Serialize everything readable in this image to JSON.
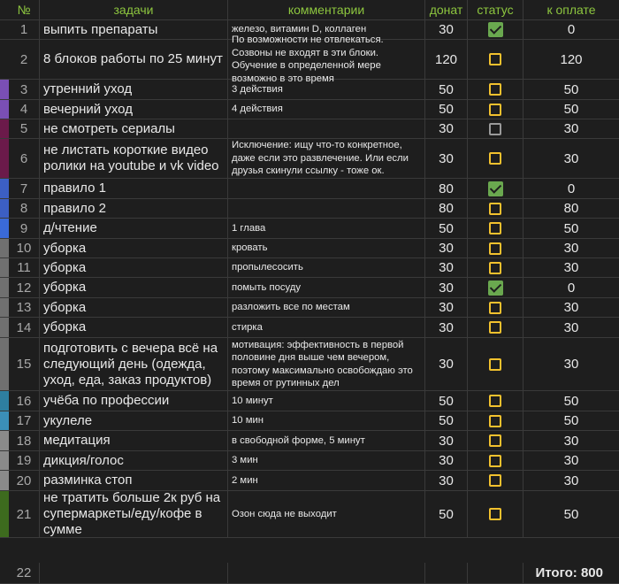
{
  "header": {
    "num": "№",
    "task": "задачи",
    "comment": "комментарии",
    "donat": "донат",
    "status": "статус",
    "pay": "к оплате"
  },
  "colors": {
    "header_text": "#8dc63f",
    "checked": "#6aa84f",
    "unchecked": "#f2c12e",
    "unchecked_gray": "#9a9a9a"
  },
  "rows": [
    {
      "num": "1",
      "task": "выпить препараты",
      "comment": "железо, витамин D, коллаген",
      "donat": "30",
      "status": "checked",
      "pay": "0",
      "strip": "#1e1e1e"
    },
    {
      "num": "2",
      "task": "8 блоков работы по 25 минут",
      "comment": "По возможности не отвлекаться. Созвоны не входят в эти блоки. Обучение в определенной мере возможно в это время",
      "donat": "120",
      "status": "unchecked",
      "pay": "120",
      "strip": "#1e1e1e"
    },
    {
      "num": "3",
      "task": "утренний уход",
      "comment": "3 действия",
      "donat": "50",
      "status": "unchecked",
      "pay": "50",
      "strip": "#7a4fb5"
    },
    {
      "num": "4",
      "task": "вечерний уход",
      "comment": "4 действия",
      "donat": "50",
      "status": "unchecked",
      "pay": "50",
      "strip": "#7a4fb5"
    },
    {
      "num": "5",
      "task": "не смотреть сериалы",
      "comment": "",
      "donat": "30",
      "status": "unchecked-gray",
      "pay": "30",
      "strip": "#6b1a4a"
    },
    {
      "num": "6",
      "task": "не листать короткие видео ролики на youtube и vk video",
      "comment": "Исключение: ищу что-то конкретное, даже если это развлечение. Или если друзья скинули ссылку - тоже ок.",
      "donat": "30",
      "status": "unchecked",
      "pay": "30",
      "strip": "#6b1a4a"
    },
    {
      "num": "7",
      "task": "правило 1",
      "comment": "",
      "donat": "80",
      "status": "checked",
      "pay": "0",
      "strip": "#3c5fc4"
    },
    {
      "num": "8",
      "task": "правило 2",
      "comment": "",
      "donat": "80",
      "status": "unchecked",
      "pay": "80",
      "strip": "#3c5fc4"
    },
    {
      "num": "9",
      "task": "д/чтение",
      "comment": "1 глава",
      "donat": "50",
      "status": "unchecked",
      "pay": "50",
      "strip": "#3a6ad8"
    },
    {
      "num": "10",
      "task": "уборка",
      "comment": "кровать",
      "donat": "30",
      "status": "unchecked",
      "pay": "30",
      "strip": "#707070"
    },
    {
      "num": "11",
      "task": "уборка",
      "comment": "пропылесосить",
      "donat": "30",
      "status": "unchecked",
      "pay": "30",
      "strip": "#707070"
    },
    {
      "num": "12",
      "task": "уборка",
      "comment": "помыть посуду",
      "donat": "30",
      "status": "checked",
      "pay": "0",
      "strip": "#707070"
    },
    {
      "num": "13",
      "task": "уборка",
      "comment": "разложить все по местам",
      "donat": "30",
      "status": "unchecked",
      "pay": "30",
      "strip": "#707070"
    },
    {
      "num": "14",
      "task": "уборка",
      "comment": "стирка",
      "donat": "30",
      "status": "unchecked",
      "pay": "30",
      "strip": "#707070"
    },
    {
      "num": "15",
      "task": "подготовить с вечера всё на следующий день (одежда, уход, еда, заказ продуктов)",
      "comment": "мотивация: эффективность в первой половине дня выше чем вечером, поэтому максимально освобождаю это время от рутинных дел",
      "donat": "30",
      "status": "unchecked",
      "pay": "30",
      "strip": "#707070"
    },
    {
      "num": "16",
      "task": "учёба по профессии",
      "comment": "10 минут",
      "donat": "50",
      "status": "unchecked",
      "pay": "50",
      "strip": "#2e7fa0"
    },
    {
      "num": "17",
      "task": "укулеле",
      "comment": "10 мин",
      "donat": "50",
      "status": "unchecked",
      "pay": "50",
      "strip": "#3b8fb8"
    },
    {
      "num": "18",
      "task": "медитация",
      "comment": "в свободной форме, 5 минут",
      "donat": "30",
      "status": "unchecked",
      "pay": "30",
      "strip": "#8a8a8a"
    },
    {
      "num": "19",
      "task": "дикция/голос",
      "comment": "3 мин",
      "donat": "30",
      "status": "unchecked",
      "pay": "30",
      "strip": "#8a8a8a"
    },
    {
      "num": "20",
      "task": "разминка стоп",
      "comment": "2 мин",
      "donat": "30",
      "status": "unchecked",
      "pay": "30",
      "strip": "#8a8a8a"
    },
    {
      "num": "21",
      "task": "не тратить больше 2к руб на супермаркеты/еду/кофе в сумме",
      "comment": "Озон сюда не выходит",
      "donat": "50",
      "status": "unchecked",
      "pay": "50",
      "strip": "#3d6b1e"
    }
  ],
  "footer": {
    "num": "22",
    "total": "Итого: 800"
  }
}
